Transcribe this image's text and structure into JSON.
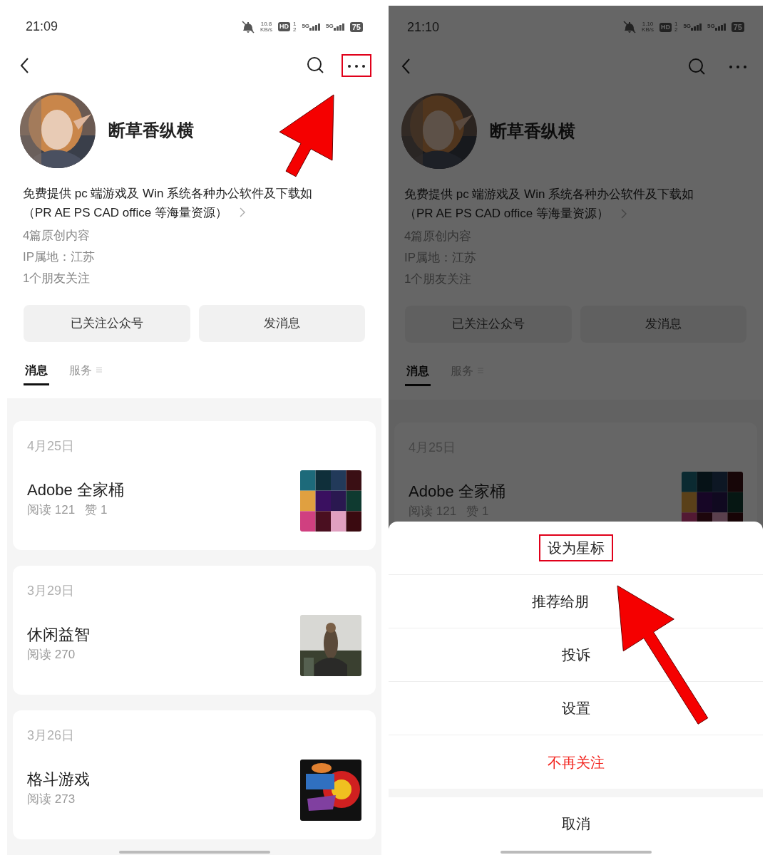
{
  "screens": [
    {
      "dimmed": false,
      "status_bar": {
        "time": "21:09",
        "speed": "10.8",
        "speed_unit": "KB/s",
        "hd": "HD",
        "sims": [
          "1",
          "2"
        ],
        "networks": [
          "5G",
          "5G"
        ],
        "battery": "75"
      },
      "nav": {
        "more_highlighted": true
      },
      "profile": {
        "avatar": {
          "kind": "picture"
        },
        "name": "断草香纵横",
        "bio": [
          "免费提供 pc 端游戏及 Win 系统各种办公软件及下载如",
          "（PR AE PS CAD office 等海量资源）"
        ],
        "facts": [
          "4篇原创内容",
          "IP属地：江苏",
          "1个朋友关注"
        ]
      },
      "buttons": [
        "已关注公众号",
        "发消息"
      ],
      "tabs": [
        {
          "label": "消息",
          "selected": true
        },
        {
          "label": "服务",
          "selected": false
        }
      ],
      "articles": [
        {
          "date": "4月25日",
          "title": "Adobe 全家桶",
          "stats": "阅读 121   赞 1",
          "thumbnail": {
            "kind": "picture"
          }
        },
        {
          "date": "3月29日",
          "title": "休闲益智",
          "stats": "阅读 270",
          "thumbnail": {
            "kind": "picture"
          }
        },
        {
          "date": "3月26日",
          "title": "格斗游戏",
          "stats": "阅读 273",
          "thumbnail": {
            "kind": "picture"
          }
        }
      ],
      "annotation_arrow": true
    },
    {
      "dimmed": true,
      "status_bar": {
        "time": "21:10",
        "speed": "1.10",
        "speed_unit": "KB/s",
        "hd": "HD",
        "sims": [
          "1",
          "2"
        ],
        "networks": [
          "5G",
          "5G"
        ],
        "battery": "75"
      },
      "nav": {
        "more_highlighted": false
      },
      "profile": {
        "avatar": {
          "kind": "picture"
        },
        "name": "断草香纵横",
        "bio": [
          "免费提供 pc 端游戏及 Win 系统各种办公软件及下载如",
          "（PR AE PS CAD office 等海量资源）"
        ],
        "facts": [
          "4篇原创内容",
          "IP属地：江苏",
          "1个朋友关注"
        ]
      },
      "buttons": [
        "已关注公众号",
        "发消息"
      ],
      "tabs": [
        {
          "label": "消息",
          "selected": true
        },
        {
          "label": "服务",
          "selected": false
        }
      ],
      "articles": [
        {
          "date": "4月25日",
          "title": "Adobe 全家桶",
          "stats": "阅读 121   赞 1",
          "thumbnail": {
            "kind": "picture"
          }
        }
      ],
      "action_sheet": {
        "items": [
          {
            "label": "设为星标",
            "kind": "normal",
            "highlighted": true
          },
          {
            "label": "推荐给朋",
            "kind": "normal",
            "highlighted": false
          },
          {
            "label": "投诉",
            "kind": "normal",
            "highlighted": false
          },
          {
            "label": "设置",
            "kind": "normal",
            "highlighted": false
          },
          {
            "label": "不再关注",
            "kind": "danger",
            "highlighted": false
          }
        ],
        "cancel": "取消"
      },
      "annotation_arrow": true
    }
  ]
}
